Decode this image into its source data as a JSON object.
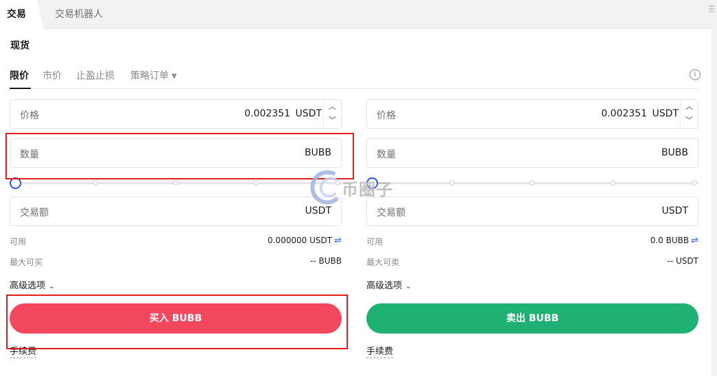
{
  "top_tabs": {
    "active": "交易",
    "other": "交易机器人"
  },
  "section_title": "现货",
  "order_tabs": {
    "items": [
      "限价",
      "市价",
      "止盈止损",
      "策略订单"
    ],
    "active_index": 0,
    "info_icon": "info-circle-icon"
  },
  "buy": {
    "price_label": "价格",
    "price_value": "0.002351",
    "price_unit": "USDT",
    "qty_label": "数量",
    "qty_unit": "BUBB",
    "amount_label": "交易额",
    "amount_unit": "USDT",
    "slider_value_percent": 0,
    "available_label": "可用",
    "available_value": "0.000000 USDT",
    "max_label": "最大可买",
    "max_value": "-- BUBB",
    "advanced_label": "高级选项",
    "action_label": "买入 BUBB",
    "fee_label": "手续费",
    "action_color": "#f2475f"
  },
  "sell": {
    "price_label": "价格",
    "price_value": "0.002351",
    "price_unit": "USDT",
    "qty_label": "数量",
    "qty_unit": "BUBB",
    "amount_label": "交易额",
    "amount_unit": "USDT",
    "slider_value_percent": 0,
    "available_label": "可用",
    "available_value": "0.0 BUBB",
    "max_label": "最大可卖",
    "max_value": "-- USDT",
    "advanced_label": "高级选项",
    "action_label": "卖出 BUBB",
    "fee_label": "手续费",
    "action_color": "#1fb173"
  },
  "watermark": {
    "text": "币圈子"
  },
  "colors": {
    "accent": "#2c54d9",
    "highlight": "#e01d1d"
  }
}
